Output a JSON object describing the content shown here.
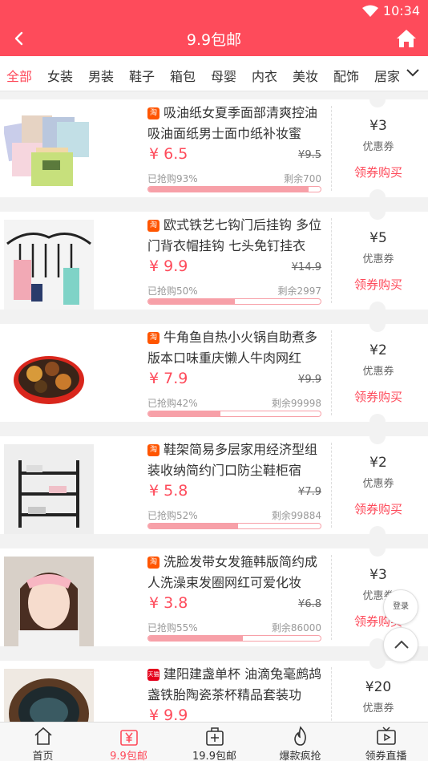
{
  "status": {
    "time": "10:34"
  },
  "nav": {
    "title": "9.9包邮"
  },
  "tabs": [
    "全部",
    "女装",
    "男装",
    "鞋子",
    "箱包",
    "母婴",
    "内衣",
    "美妆",
    "配饰",
    "居家"
  ],
  "colors": {
    "accent": "#fe4b5b",
    "progress": "#f7a0a8"
  },
  "products": [
    {
      "shop": "taobao",
      "shop_badge": "淘",
      "name": "吸油纸女夏季面部清爽控油吸油面纸男士面巾纸补妆蜜粉…",
      "price": "¥ 6.5",
      "orig_price": "¥9.5",
      "sold_text": "已抢购93%",
      "progress": 0.93,
      "remain": "剩余700",
      "coupon_value": "¥3",
      "coupon_label": "优惠券",
      "coupon_btn": "领券购买"
    },
    {
      "shop": "taobao",
      "shop_badge": "淘",
      "name": "欧式铁艺七钩门后挂钩 多位门背衣帽挂钩 七头免钉挂衣钩…",
      "price": "¥ 9.9",
      "orig_price": "¥14.9",
      "sold_text": "已抢购50%",
      "progress": 0.5,
      "remain": "剩余2997",
      "coupon_value": "¥5",
      "coupon_label": "优惠券",
      "coupon_btn": "领券购买"
    },
    {
      "shop": "taobao",
      "shop_badge": "淘",
      "name": "牛角鱼自热小火锅自助煮多版本口味重庆懒人牛肉网红方…",
      "price": "¥ 7.9",
      "orig_price": "¥9.9",
      "sold_text": "已抢购42%",
      "progress": 0.42,
      "remain": "剩余99998",
      "coupon_value": "¥2",
      "coupon_label": "优惠券",
      "coupon_btn": "领券购买"
    },
    {
      "shop": "taobao",
      "shop_badge": "淘",
      "name": "鞋架简易多层家用经济型组装收纳简约门口防尘鞋柜宿舍…",
      "price": "¥ 5.8",
      "orig_price": "¥7.9",
      "sold_text": "已抢购52%",
      "progress": 0.52,
      "remain": "剩余99884",
      "coupon_value": "¥2",
      "coupon_label": "优惠券",
      "coupon_btn": "领券购买"
    },
    {
      "shop": "taobao",
      "shop_badge": "淘",
      "name": "洗脸发带女发箍韩版简约成人洗澡束发圈网红可爱化妆头…",
      "price": "¥ 3.8",
      "orig_price": "¥6.8",
      "sold_text": "已抢购55%",
      "progress": 0.55,
      "remain": "剩余86000",
      "coupon_value": "¥3",
      "coupon_label": "优惠券",
      "coupon_btn": "领券购买"
    },
    {
      "shop": "tmall",
      "shop_badge": "天猫",
      "name": "建阳建盏单杯 油滴兔毫鹧鸪盏铁胎陶瓷茶杯精品套装功夫…",
      "price": "¥ 9.9",
      "orig_price": "",
      "sold_text": "",
      "progress": 0,
      "remain": "",
      "coupon_value": "¥20",
      "coupon_label": "优惠券",
      "coupon_btn": ""
    }
  ],
  "float": {
    "login": "登录"
  },
  "tabbar": [
    "首页",
    "9.9包邮",
    "19.9包邮",
    "爆款疯抢",
    "领券直播"
  ]
}
